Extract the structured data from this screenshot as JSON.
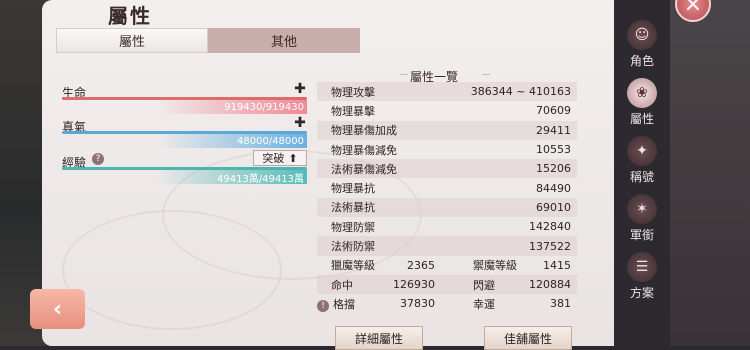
{
  "header": {
    "title": "屬性"
  },
  "tabs": [
    {
      "label": "屬性"
    },
    {
      "label": "其他"
    }
  ],
  "stats": {
    "life": {
      "label": "生命",
      "value": "919430/919430"
    },
    "qi": {
      "label": "真氣",
      "value": "48000/48000"
    },
    "exp": {
      "label": "經驗",
      "value": "49413萬/49413萬",
      "breakthrough": "突破"
    }
  },
  "attributes": {
    "title": "屬性一覽",
    "rows": [
      {
        "name": "物理攻擊",
        "value": "386344 ~ 410163"
      },
      {
        "name": "物理暴擊",
        "value": "70609"
      },
      {
        "name": "物理暴傷加成",
        "value": "29411"
      },
      {
        "name": "物理暴傷減免",
        "value": "10553"
      },
      {
        "name": "法術暴傷減免",
        "value": "15206"
      },
      {
        "name": "物理暴抗",
        "value": "84490"
      },
      {
        "name": "法術暴抗",
        "value": "69010"
      },
      {
        "name": "物理防禦",
        "value": "142840"
      },
      {
        "name": "法術防禦",
        "value": "137522"
      }
    ],
    "split_rows": [
      {
        "a": "獵魔等級",
        "b": "2365",
        "c": "禦魔等級",
        "d": "1415"
      },
      {
        "a": "命中",
        "b": "126930",
        "c": "閃避",
        "d": "120884"
      },
      {
        "a": "格擋",
        "b": "37830",
        "c": "幸運",
        "d": "381"
      }
    ]
  },
  "buttons": {
    "detail": "詳細屬性",
    "jiaxu": "佳舖屬性"
  },
  "side_nav": [
    {
      "label": "角色",
      "icon": "character-icon"
    },
    {
      "label": "屬性",
      "icon": "attribute-icon"
    },
    {
      "label": "稱號",
      "icon": "title-icon"
    },
    {
      "label": "軍銜",
      "icon": "rank-icon"
    },
    {
      "label": "方案",
      "icon": "plan-icon"
    }
  ],
  "colors": {
    "life_bar": "#e06a6a",
    "qi_bar": "#5aa7d8",
    "exp_bar": "#4fb3b0"
  }
}
